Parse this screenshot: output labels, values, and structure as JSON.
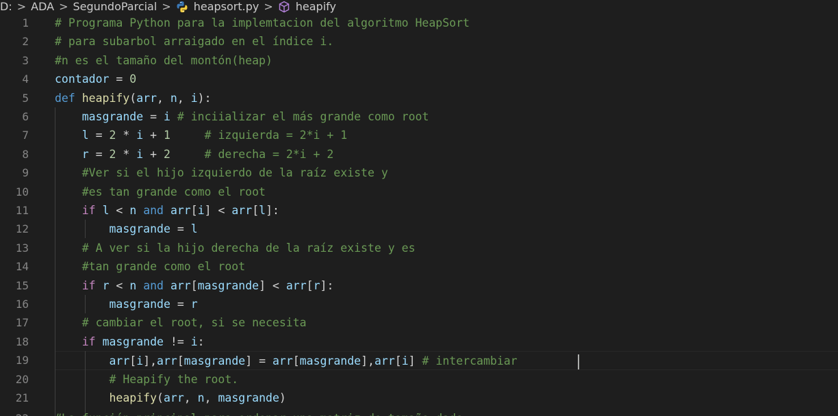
{
  "breadcrumb": {
    "items": [
      "D:",
      "ADA",
      "SegundoParcial",
      "heapsort.py",
      "heapify"
    ],
    "separator": ">"
  },
  "icons": {
    "python_file": "python-icon",
    "symbol": "symbol-method-icon"
  },
  "colors": {
    "background": "#1e1e1e",
    "comment": "#6a9955",
    "keyword": "#569cd6",
    "function": "#dcdcaa",
    "variable": "#9cdcfe",
    "number": "#b5cea8",
    "line_number": "#858585"
  },
  "editor": {
    "current_line": 19,
    "lines": [
      {
        "n": "1",
        "tokens": [
          {
            "t": "# Programa Python para la implemtacion del algoritmo HeapSort",
            "c": "cm"
          }
        ]
      },
      {
        "n": "2",
        "tokens": [
          {
            "t": "# para subarbol arraigado en el índice i.",
            "c": "cm"
          }
        ]
      },
      {
        "n": "3",
        "tokens": [
          {
            "t": "#n es el tamaño del montón(heap)",
            "c": "cm"
          }
        ]
      },
      {
        "n": "4",
        "tokens": [
          {
            "t": "contador",
            "c": "var"
          },
          {
            "t": " = ",
            "c": "op"
          },
          {
            "t": "0",
            "c": "num"
          }
        ]
      },
      {
        "n": "5",
        "tokens": [
          {
            "t": "def",
            "c": "kw"
          },
          {
            "t": " ",
            "c": "op"
          },
          {
            "t": "heapify",
            "c": "fn"
          },
          {
            "t": "(",
            "c": "op"
          },
          {
            "t": "arr",
            "c": "var"
          },
          {
            "t": ", ",
            "c": "op"
          },
          {
            "t": "n",
            "c": "var"
          },
          {
            "t": ", ",
            "c": "op"
          },
          {
            "t": "i",
            "c": "var"
          },
          {
            "t": "):",
            "c": "op"
          }
        ]
      },
      {
        "n": "6",
        "tokens": [
          {
            "t": "    ",
            "c": "op"
          },
          {
            "t": "masgrande",
            "c": "var"
          },
          {
            "t": " = ",
            "c": "op"
          },
          {
            "t": "i",
            "c": "var"
          },
          {
            "t": " # inciializar el más grande como root",
            "c": "cm"
          }
        ]
      },
      {
        "n": "7",
        "tokens": [
          {
            "t": "    ",
            "c": "op"
          },
          {
            "t": "l",
            "c": "var"
          },
          {
            "t": " = ",
            "c": "op"
          },
          {
            "t": "2",
            "c": "num"
          },
          {
            "t": " * ",
            "c": "op"
          },
          {
            "t": "i",
            "c": "var"
          },
          {
            "t": " + ",
            "c": "op"
          },
          {
            "t": "1",
            "c": "num"
          },
          {
            "t": "     # izquierda = 2*i + 1",
            "c": "cm"
          }
        ]
      },
      {
        "n": "8",
        "tokens": [
          {
            "t": "    ",
            "c": "op"
          },
          {
            "t": "r",
            "c": "var"
          },
          {
            "t": " = ",
            "c": "op"
          },
          {
            "t": "2",
            "c": "num"
          },
          {
            "t": " * ",
            "c": "op"
          },
          {
            "t": "i",
            "c": "var"
          },
          {
            "t": " + ",
            "c": "op"
          },
          {
            "t": "2",
            "c": "num"
          },
          {
            "t": "     # derecha = 2*i + 2",
            "c": "cm"
          }
        ]
      },
      {
        "n": "9",
        "tokens": [
          {
            "t": "    ",
            "c": "op"
          },
          {
            "t": "#Ver si el hijo izquierdo de la raíz existe y",
            "c": "cm"
          }
        ]
      },
      {
        "n": "10",
        "tokens": [
          {
            "t": "    ",
            "c": "op"
          },
          {
            "t": "#es tan grande como el root",
            "c": "cm"
          }
        ]
      },
      {
        "n": "11",
        "tokens": [
          {
            "t": "    ",
            "c": "op"
          },
          {
            "t": "if",
            "c": "ctrl"
          },
          {
            "t": " ",
            "c": "op"
          },
          {
            "t": "l",
            "c": "var"
          },
          {
            "t": " < ",
            "c": "op"
          },
          {
            "t": "n",
            "c": "var"
          },
          {
            "t": " ",
            "c": "op"
          },
          {
            "t": "and",
            "c": "kw"
          },
          {
            "t": " ",
            "c": "op"
          },
          {
            "t": "arr",
            "c": "var"
          },
          {
            "t": "[",
            "c": "op"
          },
          {
            "t": "i",
            "c": "var"
          },
          {
            "t": "] < ",
            "c": "op"
          },
          {
            "t": "arr",
            "c": "var"
          },
          {
            "t": "[",
            "c": "op"
          },
          {
            "t": "l",
            "c": "var"
          },
          {
            "t": "]:",
            "c": "op"
          }
        ]
      },
      {
        "n": "12",
        "tokens": [
          {
            "t": "        ",
            "c": "op"
          },
          {
            "t": "masgrande",
            "c": "var"
          },
          {
            "t": " = ",
            "c": "op"
          },
          {
            "t": "l",
            "c": "var"
          }
        ]
      },
      {
        "n": "13",
        "tokens": [
          {
            "t": "    ",
            "c": "op"
          },
          {
            "t": "# A ver si la hijo derecha de la raíz existe y es",
            "c": "cm"
          }
        ]
      },
      {
        "n": "14",
        "tokens": [
          {
            "t": "    ",
            "c": "op"
          },
          {
            "t": "#tan grande como el root",
            "c": "cm"
          }
        ]
      },
      {
        "n": "15",
        "tokens": [
          {
            "t": "    ",
            "c": "op"
          },
          {
            "t": "if",
            "c": "ctrl"
          },
          {
            "t": " ",
            "c": "op"
          },
          {
            "t": "r",
            "c": "var"
          },
          {
            "t": " < ",
            "c": "op"
          },
          {
            "t": "n",
            "c": "var"
          },
          {
            "t": " ",
            "c": "op"
          },
          {
            "t": "and",
            "c": "kw"
          },
          {
            "t": " ",
            "c": "op"
          },
          {
            "t": "arr",
            "c": "var"
          },
          {
            "t": "[",
            "c": "op"
          },
          {
            "t": "masgrande",
            "c": "var"
          },
          {
            "t": "] < ",
            "c": "op"
          },
          {
            "t": "arr",
            "c": "var"
          },
          {
            "t": "[",
            "c": "op"
          },
          {
            "t": "r",
            "c": "var"
          },
          {
            "t": "]:",
            "c": "op"
          }
        ]
      },
      {
        "n": "16",
        "tokens": [
          {
            "t": "        ",
            "c": "op"
          },
          {
            "t": "masgrande",
            "c": "var"
          },
          {
            "t": " = ",
            "c": "op"
          },
          {
            "t": "r",
            "c": "var"
          }
        ]
      },
      {
        "n": "17",
        "tokens": [
          {
            "t": "    ",
            "c": "op"
          },
          {
            "t": "# cambiar el root, si se necesita",
            "c": "cm"
          }
        ]
      },
      {
        "n": "18",
        "tokens": [
          {
            "t": "    ",
            "c": "op"
          },
          {
            "t": "if",
            "c": "ctrl"
          },
          {
            "t": " ",
            "c": "op"
          },
          {
            "t": "masgrande",
            "c": "var"
          },
          {
            "t": " != ",
            "c": "op"
          },
          {
            "t": "i",
            "c": "var"
          },
          {
            "t": ":",
            "c": "op"
          }
        ]
      },
      {
        "n": "19",
        "tokens": [
          {
            "t": "        ",
            "c": "op"
          },
          {
            "t": "arr",
            "c": "var"
          },
          {
            "t": "[",
            "c": "op"
          },
          {
            "t": "i",
            "c": "var"
          },
          {
            "t": "],",
            "c": "op"
          },
          {
            "t": "arr",
            "c": "var"
          },
          {
            "t": "[",
            "c": "op"
          },
          {
            "t": "masgrande",
            "c": "var"
          },
          {
            "t": "] = ",
            "c": "op"
          },
          {
            "t": "arr",
            "c": "var"
          },
          {
            "t": "[",
            "c": "op"
          },
          {
            "t": "masgrande",
            "c": "var"
          },
          {
            "t": "],",
            "c": "op"
          },
          {
            "t": "arr",
            "c": "var"
          },
          {
            "t": "[",
            "c": "op"
          },
          {
            "t": "i",
            "c": "var"
          },
          {
            "t": "] ",
            "c": "op"
          },
          {
            "t": "# intercambiar ",
            "c": "cm"
          }
        ]
      },
      {
        "n": "20",
        "tokens": [
          {
            "t": "        ",
            "c": "op"
          },
          {
            "t": "# Heapify the root.",
            "c": "cm"
          }
        ]
      },
      {
        "n": "21",
        "tokens": [
          {
            "t": "        ",
            "c": "op"
          },
          {
            "t": "heapify",
            "c": "fn"
          },
          {
            "t": "(",
            "c": "op"
          },
          {
            "t": "arr",
            "c": "var"
          },
          {
            "t": ", ",
            "c": "op"
          },
          {
            "t": "n",
            "c": "var"
          },
          {
            "t": ", ",
            "c": "op"
          },
          {
            "t": "masgrande",
            "c": "var"
          },
          {
            "t": ")",
            "c": "op"
          }
        ]
      }
    ],
    "partial_line": {
      "n": "22",
      "text": "#La función principal para ordenar una matriz de tamaño dado"
    }
  }
}
